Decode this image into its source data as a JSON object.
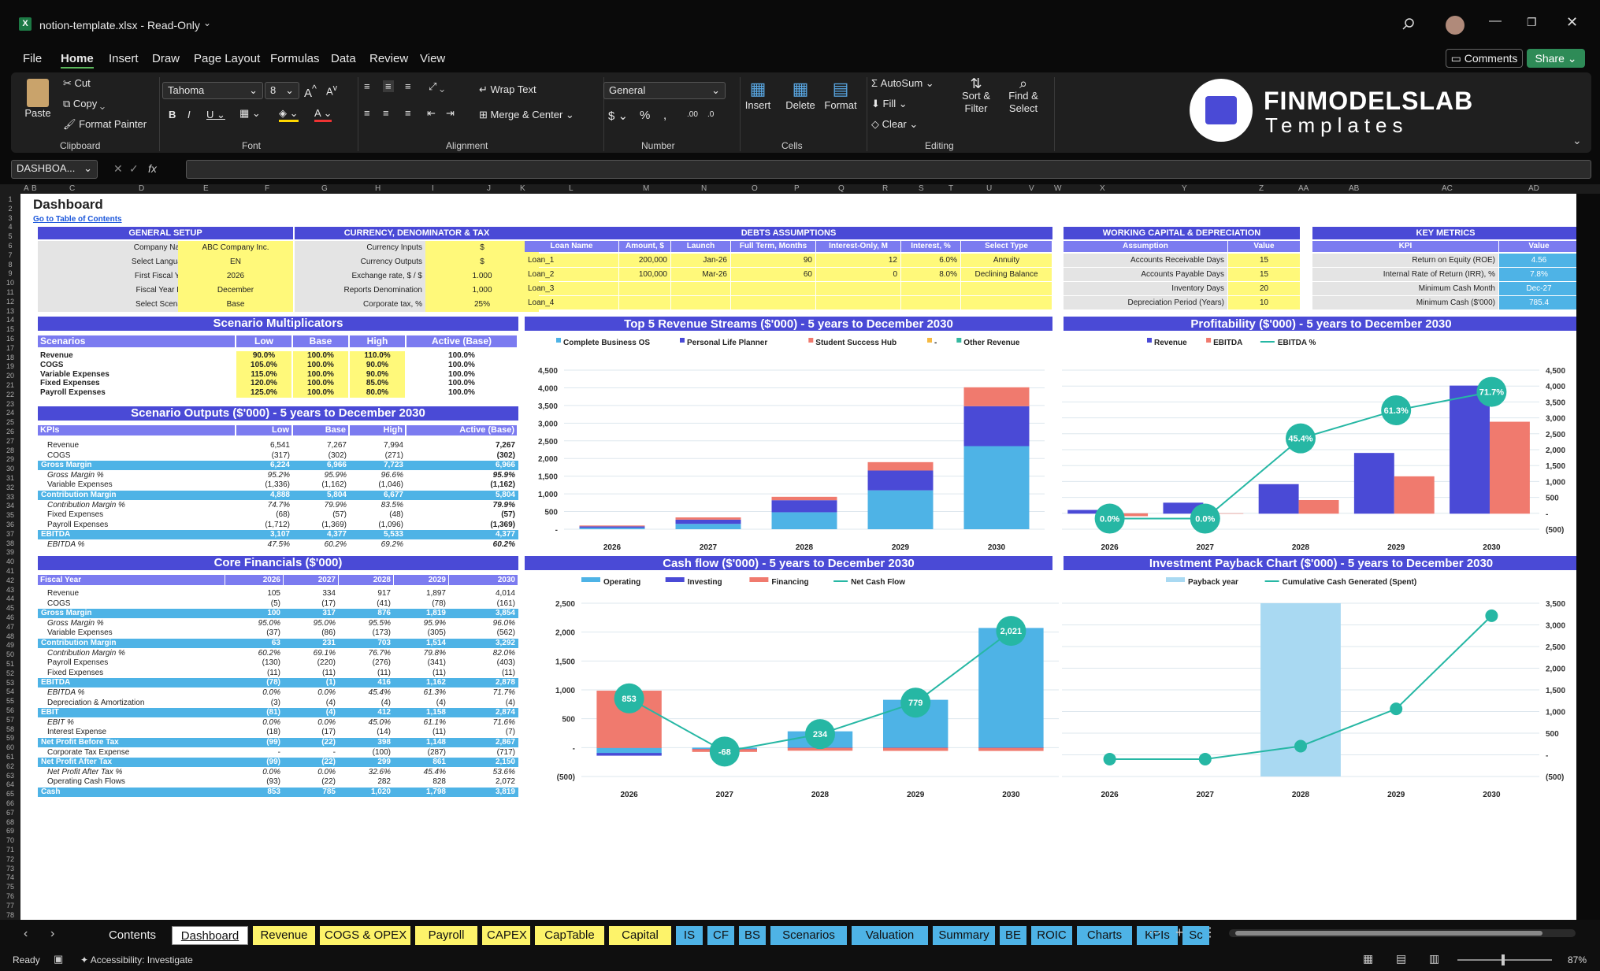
{
  "window": {
    "title": "notion-template.xlsx - Read-Only"
  },
  "menu": [
    "File",
    "Home",
    "Insert",
    "Draw",
    "Page Layout",
    "Formulas",
    "Data",
    "Review",
    "View"
  ],
  "buttons": {
    "comments": "Comments",
    "share": "Share"
  },
  "ribbon": {
    "paste": "Paste",
    "cut": "Cut",
    "copy": "Copy",
    "format_painter": "Format Painter",
    "font_name": "Tahoma",
    "font_size": "8",
    "wrap_text": "Wrap Text",
    "merge_center": "Merge & Center",
    "number_format": "General",
    "insert": "Insert",
    "delete": "Delete",
    "format": "Format",
    "autosum": "AutoSum",
    "fill": "Fill",
    "clear": "Clear",
    "sort_filter": "Sort & Filter",
    "find_select": "Find & Select",
    "groups": [
      "Clipboard",
      "Font",
      "Alignment",
      "Number",
      "Cells",
      "Editing"
    ]
  },
  "logo": {
    "line1": "FINMODELSLAB",
    "line2": "Templates"
  },
  "formula_bar": {
    "name_box": "DASHBOA...",
    "fx": "fx",
    "value": ""
  },
  "column_headers": [
    "A",
    "B",
    "C",
    "D",
    "E",
    "F",
    "G",
    "H",
    "I",
    "J",
    "K",
    "L",
    "M",
    "N",
    "O",
    "P",
    "Q",
    "R",
    "S",
    "T",
    "U",
    "V",
    "W",
    "X",
    "Y",
    "Z",
    "AA",
    "AB",
    "AC",
    "AD"
  ],
  "sheet": {
    "title": "Dashboard",
    "link": "Go to Table of Contents",
    "general_setup": {
      "header": "GENERAL SETUP",
      "rows": [
        [
          "Company Name",
          "ABC Company Inc."
        ],
        [
          "Select Language",
          "EN"
        ],
        [
          "First Fiscal Year",
          "2026"
        ],
        [
          "Fiscal Year End",
          "December"
        ],
        [
          "Select Scenario",
          "Base"
        ]
      ]
    },
    "currency": {
      "header": "CURRENCY, DENOMINATOR & TAX",
      "rows": [
        [
          "Currency Inputs",
          "$"
        ],
        [
          "Currency Outputs",
          "$"
        ],
        [
          "Exchange rate, $ / $",
          "1.000"
        ],
        [
          "Reports Denomination",
          "1,000"
        ],
        [
          "Corporate tax, %",
          "25%"
        ]
      ]
    },
    "debts": {
      "header": "DEBTS ASSUMPTIONS",
      "cols": [
        "Loan Name",
        "Amount, $",
        "Launch",
        "Full Term, Months",
        "Interest-Only, M",
        "Interest, %",
        "Select Type"
      ],
      "rows": [
        [
          "Loan_1",
          "200,000",
          "Jan-26",
          "90",
          "12",
          "6.0%",
          "Annuity"
        ],
        [
          "Loan_2",
          "100,000",
          "Mar-26",
          "60",
          "0",
          "8.0%",
          "Declining Balance"
        ],
        [
          "Loan_3",
          "",
          "",
          "",
          "",
          "",
          ""
        ],
        [
          "Loan_4",
          "",
          "",
          "",
          "",
          "",
          ""
        ]
      ]
    },
    "working_capital": {
      "header": "WORKING CAPITAL & DEPRECIATION",
      "cols": [
        "Assumption",
        "Value"
      ],
      "rows": [
        [
          "Accounts Receivable Days",
          "15"
        ],
        [
          "Accounts Payable Days",
          "15"
        ],
        [
          "Inventory Days",
          "20"
        ],
        [
          "Depreciation Period (Years)",
          "10"
        ]
      ]
    },
    "key_metrics": {
      "header": "KEY METRICS",
      "cols": [
        "KPI",
        "Value"
      ],
      "rows": [
        [
          "Return on Equity (ROE)",
          "4.56"
        ],
        [
          "Internal Rate of Return (IRR), %",
          "7.8%"
        ],
        [
          "Minimum Cash Month",
          "Dec-27"
        ],
        [
          "Minimum Cash ($'000)",
          "785.4"
        ]
      ]
    },
    "scenario_mult": {
      "header": "Scenario Multiplicators",
      "cols": [
        "Scenarios",
        "Low",
        "Base",
        "High",
        "Active (Base)"
      ],
      "rows": [
        [
          "Revenue",
          "90.0%",
          "100.0%",
          "110.0%",
          "100.0%"
        ],
        [
          "COGS",
          "105.0%",
          "100.0%",
          "90.0%",
          "100.0%"
        ],
        [
          "Variable Expenses",
          "115.0%",
          "100.0%",
          "90.0%",
          "100.0%"
        ],
        [
          "Fixed Expenses",
          "120.0%",
          "100.0%",
          "85.0%",
          "100.0%"
        ],
        [
          "Payroll Expenses",
          "125.0%",
          "100.0%",
          "80.0%",
          "100.0%"
        ]
      ]
    },
    "scenario_out": {
      "header": "Scenario Outputs ($'000) - 5 years to December 2030",
      "cols": [
        "KPIs",
        "Low",
        "Base",
        "High",
        "Active (Base)"
      ],
      "rows": [
        [
          "Revenue",
          "6,541",
          "7,267",
          "7,994",
          "7,267",
          "n"
        ],
        [
          "COGS",
          "(317)",
          "(302)",
          "(271)",
          "(302)",
          "n"
        ],
        [
          "Gross Margin",
          "6,224",
          "6,966",
          "7,723",
          "6,966",
          "h"
        ],
        [
          "Gross Margin %",
          "95.2%",
          "95.9%",
          "96.6%",
          "95.9%",
          "i"
        ],
        [
          "Variable Expenses",
          "(1,336)",
          "(1,162)",
          "(1,046)",
          "(1,162)",
          "n"
        ],
        [
          "Contribution Margin",
          "4,888",
          "5,804",
          "6,677",
          "5,804",
          "h"
        ],
        [
          "Contribution Margin %",
          "74.7%",
          "79.9%",
          "83.5%",
          "79.9%",
          "i"
        ],
        [
          "Fixed Expenses",
          "(68)",
          "(57)",
          "(48)",
          "(57)",
          "n"
        ],
        [
          "Payroll Expenses",
          "(1,712)",
          "(1,369)",
          "(1,096)",
          "(1,369)",
          "n"
        ],
        [
          "EBITDA",
          "3,107",
          "4,377",
          "5,533",
          "4,377",
          "h"
        ],
        [
          "EBITDA %",
          "47.5%",
          "60.2%",
          "69.2%",
          "60.2%",
          "i"
        ]
      ]
    },
    "core": {
      "header": "Core Financials ($'000)",
      "cols": [
        "Fiscal Year",
        "2026",
        "2027",
        "2028",
        "2029",
        "2030"
      ],
      "rows": [
        [
          "Revenue",
          "105",
          "334",
          "917",
          "1,897",
          "4,014",
          "n"
        ],
        [
          "COGS",
          "(5)",
          "(17)",
          "(41)",
          "(78)",
          "(161)",
          "n"
        ],
        [
          "Gross Margin",
          "100",
          "317",
          "876",
          "1,819",
          "3,854",
          "h"
        ],
        [
          "Gross Margin %",
          "95.0%",
          "95.0%",
          "95.5%",
          "95.9%",
          "96.0%",
          "i"
        ],
        [
          "Variable Expenses",
          "(37)",
          "(86)",
          "(173)",
          "(305)",
          "(562)",
          "n"
        ],
        [
          "Contribution Margin",
          "63",
          "231",
          "703",
          "1,514",
          "3,292",
          "h"
        ],
        [
          "Contribution Margin %",
          "60.2%",
          "69.1%",
          "76.7%",
          "79.8%",
          "82.0%",
          "i"
        ],
        [
          "Payroll Expenses",
          "(130)",
          "(220)",
          "(276)",
          "(341)",
          "(403)",
          "n"
        ],
        [
          "Fixed Expenses",
          "(11)",
          "(11)",
          "(11)",
          "(11)",
          "(11)",
          "n"
        ],
        [
          "EBITDA",
          "(78)",
          "(1)",
          "416",
          "1,162",
          "2,878",
          "h"
        ],
        [
          "EBITDA %",
          "0.0%",
          "0.0%",
          "45.4%",
          "61.3%",
          "71.7%",
          "i"
        ],
        [
          "Depreciation & Amortization",
          "(3)",
          "(4)",
          "(4)",
          "(4)",
          "(4)",
          "n"
        ],
        [
          "EBIT",
          "(81)",
          "(4)",
          "412",
          "1,158",
          "2,874",
          "h"
        ],
        [
          "EBIT %",
          "0.0%",
          "0.0%",
          "45.0%",
          "61.1%",
          "71.6%",
          "i"
        ],
        [
          "Interest Expense",
          "(18)",
          "(17)",
          "(14)",
          "(11)",
          "(7)",
          "n"
        ],
        [
          "Net Profit Before Tax",
          "(99)",
          "(22)",
          "398",
          "1,148",
          "2,867",
          "h"
        ],
        [
          "Corporate Tax Expense",
          "-",
          "-",
          "(100)",
          "(287)",
          "(717)",
          "n"
        ],
        [
          "Net Profit After Tax",
          "(99)",
          "(22)",
          "299",
          "861",
          "2,150",
          "h"
        ],
        [
          "Net Profit After Tax %",
          "0.0%",
          "0.0%",
          "32.6%",
          "45.4%",
          "53.6%",
          "i"
        ],
        [
          "Operating Cash Flows",
          "(93)",
          "(22)",
          "282",
          "828",
          "2,072",
          "n"
        ],
        [
          "Cash",
          "853",
          "785",
          "1,020",
          "1,798",
          "3,819",
          "h"
        ]
      ]
    }
  },
  "chart_data": [
    {
      "type": "bar",
      "stacked": true,
      "title": "Top 5 Revenue Streams ($'000) - 5 years to December 2030",
      "categories": [
        "2026",
        "2027",
        "2028",
        "2029",
        "2030"
      ],
      "ylim": [
        0,
        4500
      ],
      "yticks": [
        "-",
        "500",
        "1,000",
        "1,500",
        "2,000",
        "2,500",
        "3,000",
        "3,500",
        "4,000",
        "4,500"
      ],
      "series": [
        {
          "name": "Complete Business OS",
          "color": "#4eb3e6",
          "values": [
            40,
            150,
            480,
            1100,
            2350
          ]
        },
        {
          "name": "Personal Life Planner",
          "color": "#4a4ad6",
          "values": [
            40,
            120,
            340,
            560,
            1130
          ]
        },
        {
          "name": "Student Success Hub",
          "color": "#f07a6e",
          "values": [
            25,
            64,
            97,
            237,
            534
          ]
        },
        {
          "name": "-",
          "color": "#f5b942",
          "values": [
            0,
            0,
            0,
            0,
            0
          ]
        },
        {
          "name": "Other Revenue",
          "color": "#35b8a0",
          "values": [
            0,
            0,
            0,
            0,
            0
          ]
        }
      ]
    },
    {
      "type": "bar+line",
      "title": "Profitability ($'000) - 5 years to December 2030",
      "categories": [
        "2026",
        "2027",
        "2028",
        "2029",
        "2030"
      ],
      "ylim": [
        -500,
        4500
      ],
      "yticks": [
        "(500)",
        "-",
        "500",
        "1,000",
        "1,500",
        "2,000",
        "2,500",
        "3,000",
        "3,500",
        "4,000",
        "4,500"
      ],
      "series": [
        {
          "name": "Revenue",
          "color": "#4a4ad6",
          "values": [
            105,
            334,
            917,
            1897,
            4014
          ]
        },
        {
          "name": "EBITDA",
          "color": "#f07a6e",
          "values": [
            -78,
            -1,
            416,
            1162,
            2878
          ]
        },
        {
          "name": "EBITDA %",
          "color": "#26b7a4",
          "values": [
            0.0,
            0.0,
            45.4,
            61.3,
            71.7
          ],
          "labels": [
            "0.0%",
            "0.0%",
            "45.4%",
            "61.3%",
            "71.7%"
          ]
        }
      ]
    },
    {
      "type": "bar+line",
      "stacked": true,
      "title": "Cash flow ($'000) - 5 years to December 2030",
      "categories": [
        "2026",
        "2027",
        "2028",
        "2029",
        "2030"
      ],
      "ylim": [
        -500,
        2500
      ],
      "yticks": [
        "(500)",
        "-",
        "500",
        "1,000",
        "1,500",
        "2,000",
        "2,500"
      ],
      "series": [
        {
          "name": "Operating",
          "color": "#4eb3e6",
          "values": [
            -93,
            -22,
            282,
            828,
            2072
          ]
        },
        {
          "name": "Investing",
          "color": "#4a4ad6",
          "values": [
            -40,
            -4,
            -4,
            -4,
            -4
          ]
        },
        {
          "name": "Financing",
          "color": "#f07a6e",
          "values": [
            986,
            -42,
            -43,
            -46,
            -47
          ]
        },
        {
          "name": "Net Cash Flow",
          "color": "#26b7a4",
          "values": [
            853,
            -68,
            234,
            779,
            2021
          ],
          "labels": [
            "853",
            "-68",
            "234",
            "779",
            "2,021"
          ]
        }
      ]
    },
    {
      "type": "bar+line",
      "title": "Investment Payback Chart ($'000) - 5 years to December 2030",
      "categories": [
        "2026",
        "2027",
        "2028",
        "2029",
        "2030"
      ],
      "ylim": [
        -500,
        3500
      ],
      "yticks": [
        "(500)",
        "-",
        "500",
        "1,000",
        "1,500",
        "2,000",
        "2,500",
        "3,000",
        "3,500"
      ],
      "series": [
        {
          "name": "Payback year",
          "color": "#a9d9f2",
          "values": [
            0,
            0,
            1,
            0,
            0
          ]
        },
        {
          "name": "Cumulative Cash Generated (Spent)",
          "color": "#26b7a4",
          "values": [
            -99,
            -99,
            200,
            1061,
            3211
          ]
        }
      ]
    }
  ],
  "tabs": [
    {
      "label": "Contents",
      "color": "#0f0f0f",
      "text": "#eee"
    },
    {
      "label": "Dashboard",
      "color": "#fff",
      "text": "#111"
    },
    {
      "label": "Revenue",
      "color": "#fdf36a"
    },
    {
      "label": "COGS & OPEX",
      "color": "#fdf36a"
    },
    {
      "label": "Payroll",
      "color": "#fdf36a"
    },
    {
      "label": "CAPEX",
      "color": "#fdf36a"
    },
    {
      "label": "CapTable",
      "color": "#fdf36a"
    },
    {
      "label": "Capital",
      "color": "#fdf36a"
    },
    {
      "label": "IS",
      "color": "#4eb3e6"
    },
    {
      "label": "CF",
      "color": "#4eb3e6"
    },
    {
      "label": "BS",
      "color": "#4eb3e6"
    },
    {
      "label": "Scenarios",
      "color": "#4eb3e6"
    },
    {
      "label": "Valuation",
      "color": "#4eb3e6"
    },
    {
      "label": "Summary",
      "color": "#4eb3e6"
    },
    {
      "label": "BE",
      "color": "#4eb3e6"
    },
    {
      "label": "ROIC",
      "color": "#4eb3e6"
    },
    {
      "label": "Charts",
      "color": "#4eb3e6"
    },
    {
      "label": "KPIs",
      "color": "#4eb3e6"
    },
    {
      "label": "Sc",
      "color": "#4eb3e6"
    }
  ],
  "status": {
    "ready": "Ready",
    "accessibility": "Accessibility: Investigate",
    "zoom": "87%"
  }
}
